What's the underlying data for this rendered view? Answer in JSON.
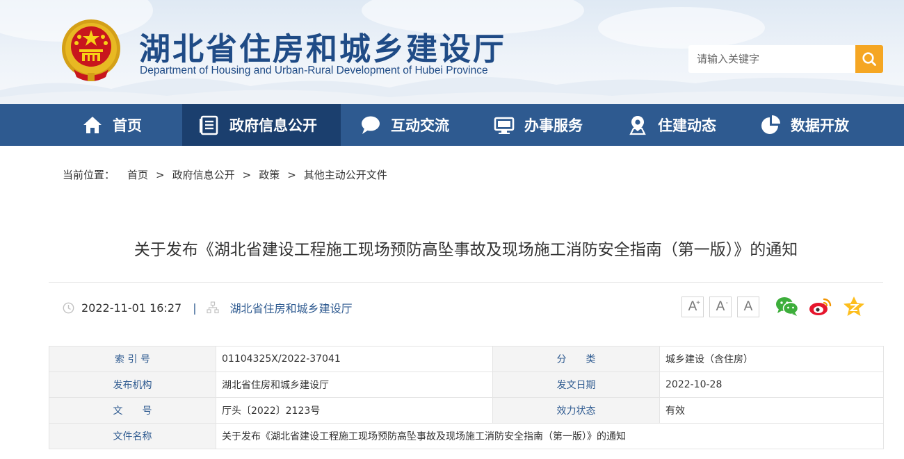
{
  "header": {
    "title": "湖北省住房和城乡建设厅",
    "subtitle": "Department of Housing and Urban-Rural Development of Hubei Province",
    "search_placeholder": "请输入关键字"
  },
  "nav": [
    {
      "label": "首页",
      "icon": "home-icon"
    },
    {
      "label": "政府信息公开",
      "icon": "document-list-icon",
      "active": true
    },
    {
      "label": "互动交流",
      "icon": "chat-bubble-icon"
    },
    {
      "label": "办事服务",
      "icon": "monitor-icon"
    },
    {
      "label": "住建动态",
      "icon": "location-pin-icon"
    },
    {
      "label": "数据开放",
      "icon": "pie-chart-icon"
    }
  ],
  "breadcrumb": {
    "prefix": "当前位置：",
    "items": [
      "首页",
      "政府信息公开",
      "政策",
      "其他主动公开文件"
    ],
    "separator": ">"
  },
  "article": {
    "title": "关于发布《湖北省建设工程施工现场预防高坠事故及现场施工消防安全指南（第一版）》的通知",
    "datetime": "2022-11-01 16:27",
    "divider": "|",
    "source": "湖北省住房和城乡建设厅"
  },
  "font_controls": [
    {
      "label": "A",
      "mark": "+"
    },
    {
      "label": "A",
      "mark": "-"
    },
    {
      "label": "A",
      "mark": ""
    }
  ],
  "share": [
    "wechat-icon",
    "weibo-icon",
    "qzone-icon"
  ],
  "colors": {
    "nav_bg": "#2e5a90",
    "nav_active_bg": "#1b3f6e",
    "title_blue": "#1f4b86",
    "search_btn": "#f5a623"
  },
  "info_table": {
    "rows": [
      {
        "l1": "索 引 号",
        "v1": "01104325X/2022-37041",
        "l2": "分　　类",
        "v2": "城乡建设（含住房）"
      },
      {
        "l1": "发布机构",
        "v1": "湖北省住房和城乡建设厅",
        "l2": "发文日期",
        "v2": "2022-10-28"
      },
      {
        "l1": "文　　号",
        "v1": "厅头〔2022〕2123号",
        "l2": "效力状态",
        "v2": "有效"
      }
    ],
    "full_row": {
      "label": "文件名称",
      "value": "关于发布《湖北省建设工程施工现场预防高坠事故及现场施工消防安全指南（第一版）》的通知"
    }
  }
}
